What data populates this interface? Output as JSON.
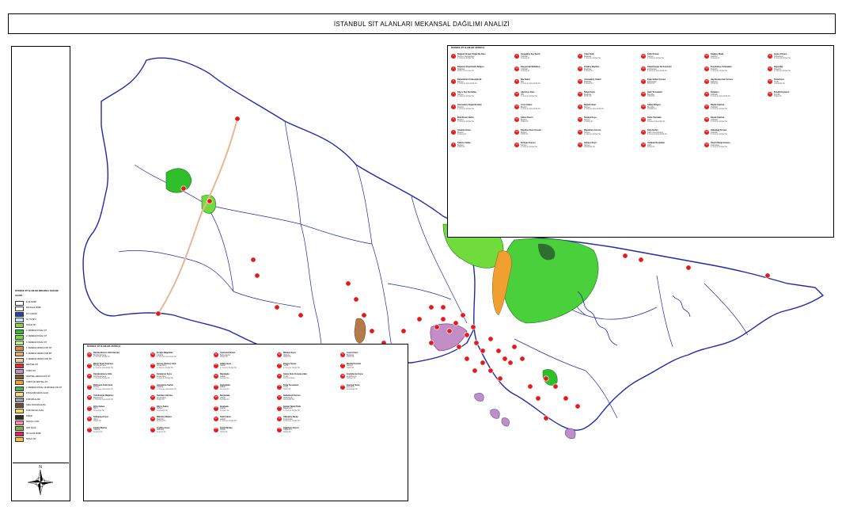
{
  "title": "İSTANBUL SİT ALANLARI MEKANSAL DAĞILIMI ANALİZİ",
  "legend": {
    "title": "İSTANBUL SİT ALANLARI MEKANSAL DAĞILIMI",
    "subtitle": "LEJANT",
    "items": [
      {
        "label": "İLÇE SINIRI",
        "color": "#ffffff"
      },
      {
        "label": "MAHALLE SINIRI",
        "color": "#ffffff"
      },
      {
        "label": "KIYI ÇİZGİSİ",
        "color": "#2a3fae"
      },
      {
        "label": "SU YÜZEYİ",
        "color": "#bfe4f7"
      },
      {
        "label": "DOĞAL SİT",
        "color": "#8ed24a"
      },
      {
        "label": "1. DERECE DOĞAL SİT",
        "color": "#2fbf2a"
      },
      {
        "label": "2. DERECE DOĞAL SİT",
        "color": "#6fdc3c"
      },
      {
        "label": "3. DERECE DOĞAL SİT",
        "color": "#b6ec86"
      },
      {
        "label": "1. DERECE ARKEOLOJİK SİT",
        "color": "#d98a4a"
      },
      {
        "label": "2. DERECE ARKEOLOJİK SİT",
        "color": "#e9a86f"
      },
      {
        "label": "3. DERECE ARKEOLOJİK SİT",
        "color": "#f3c9a0"
      },
      {
        "label": "KENTSEL SİT",
        "color": "#e03030"
      },
      {
        "label": "TARİHİ SİT",
        "color": "#c28ec6"
      },
      {
        "label": "KENTSEL ARKEOLOJİK SİT",
        "color": "#8c5a2a"
      },
      {
        "label": "TARİHİ VE KENTSEL SİT",
        "color": "#f0a030"
      },
      {
        "label": "1. DERECE DOĞAL VE ARKEOLOJİK SİT",
        "color": "#4caf50"
      },
      {
        "label": "ETKİLEŞİM GEÇİŞ ALANI",
        "color": "#f7e08a"
      },
      {
        "label": "KORUMA ALANI",
        "color": "#9e9e9e"
      },
      {
        "label": "ÖZEL KORUMA ALANI",
        "color": "#6d4c41"
      },
      {
        "label": "KORUNACAK ALAN",
        "color": "#ffd54f"
      },
      {
        "label": "DİĞER",
        "color": "#3e2723"
      },
      {
        "label": "TESCİLLİ YAPI",
        "color": "#f48fb1"
      },
      {
        "label": "ANIT AĞAÇ",
        "color": "#7cb342"
      },
      {
        "label": "SİT ALANI SINIRI",
        "color": "#e91e63"
      },
      {
        "label": "TESCİL NO",
        "color": "#fbc02d"
      }
    ]
  },
  "north_arrow": {
    "icon": "compass-rose-icon",
    "label": "N"
  },
  "tables": {
    "right": {
      "heading": "İSTANBUL SİT ALANLARI LİSTESİ (1)",
      "entries": [
        {
          "n": "1",
          "name": "Belgrad Ormanı Doğal Sit Alanı",
          "sub": "Sarıyer / Eyüpsultan",
          "detail": "1. Derece Doğal Sit"
        },
        {
          "n": "2",
          "name": "Boğaziçi Öngörünüm Bölgesi",
          "sub": "Beşiktaş",
          "detail": "Tarihi ve Kentsel Sit"
        },
        {
          "n": "3",
          "name": "Rumelifeneri Arkeolojik Sit",
          "sub": "Sarıyer",
          "detail": "1. Derece Arkeolojik Sit"
        },
        {
          "n": "4",
          "name": "Kilyos Kıyı Kumulları",
          "sub": "Sarıyer",
          "detail": "2. Derece Doğal Sit"
        },
        {
          "n": "5",
          "name": "Polonezköy Doğal Sit Alanı",
          "sub": "Beykoz",
          "detail": "1. Derece Doğal Sit"
        },
        {
          "n": "6",
          "name": "Riva Deresi Vadisi",
          "sub": "Beykoz",
          "detail": "2. Derece Doğal Sit"
        },
        {
          "n": "7",
          "name": "Anadolu Hisarı",
          "sub": "Beykoz",
          "detail": "Kentsel Sit"
        },
        {
          "n": "8",
          "name": "Kanlıca Yalıları",
          "sub": "Beykoz",
          "detail": "Tarihi Sit"
        },
        {
          "n": "9",
          "name": "Çengelköy Kıyı Şeridi",
          "sub": "Üsküdar",
          "detail": "Kentsel Sit"
        },
        {
          "n": "10",
          "name": "Kuzguncuk Mahallesi",
          "sub": "Üsküdar",
          "detail": "Kentsel Sit"
        },
        {
          "n": "11",
          "name": "Şile Kalesi",
          "sub": "Şile",
          "detail": "1. Derece Arkeolojik Sit"
        },
        {
          "n": "12",
          "name": "Ağva Kıyı Alanı",
          "sub": "Şile",
          "detail": "2. Derece Doğal Sit"
        },
        {
          "n": "13",
          "name": "Yoros Kalesi",
          "sub": "Beykoz",
          "detail": "1. Derece Arkeolojik Sit"
        },
        {
          "n": "14",
          "name": "Göksu Deresi",
          "sub": "Beykoz",
          "detail": "Doğal Sit"
        },
        {
          "n": "15",
          "name": "Küçüksu Kasrı Çevresi",
          "sub": "Beykoz",
          "detail": "Tarihi Sit"
        },
        {
          "n": "16",
          "name": "Emirgan Korusu",
          "sub": "Sarıyer",
          "detail": "1. Derece Doğal Sit"
        },
        {
          "n": "17",
          "name": "Yıldız Parkı",
          "sub": "Beşiktaş",
          "detail": "1. Derece Doğal Sit"
        },
        {
          "n": "18",
          "name": "Ortaköy Meydanı",
          "sub": "Beşiktaş",
          "detail": "Kentsel Sit"
        },
        {
          "n": "19",
          "name": "Arnavutköy Yalıları",
          "sub": "Beşiktaş",
          "detail": "Kentsel Sit"
        },
        {
          "n": "20",
          "name": "Bebek Koyu",
          "sub": "Beşiktaş",
          "detail": "Tarihi Sit"
        },
        {
          "n": "21",
          "name": "Rumeli Hisarı",
          "sub": "Sarıyer",
          "detail": "1. Derece Arkeolojik Sit"
        },
        {
          "n": "22",
          "name": "Tarabya Koyu",
          "sub": "Sarıyer",
          "detail": "Kentsel Sit"
        },
        {
          "n": "23",
          "name": "Büyükdere Korusu",
          "sub": "Sarıyer",
          "detail": "2. Derece Doğal Sit"
        },
        {
          "n": "24",
          "name": "Garipçe Köyü",
          "sub": "Sarıyer",
          "detail": "Arkeolojik Sit"
        },
        {
          "n": "25",
          "name": "Fatih Ormanı",
          "sub": "Sarıyer",
          "detail": "1. Derece Doğal Sit"
        },
        {
          "n": "26",
          "name": "Kemerburgaz Su Kemerleri",
          "sub": "Eyüpsultan",
          "detail": "1. Derece Arkeolojik Sit"
        },
        {
          "n": "27",
          "name": "Eyüp Sultan Çevresi",
          "sub": "Eyüpsultan",
          "detail": "Tarihi Sit"
        },
        {
          "n": "28",
          "name": "Haliç Tersaneleri",
          "sub": "Beyoğlu",
          "detail": "Tarihi Sit"
        },
        {
          "n": "29",
          "name": "Galata Bölgesi",
          "sub": "Beyoğlu",
          "detail": "Kentsel Sit"
        },
        {
          "n": "30",
          "name": "Tarihi Yarımada",
          "sub": "Fatih",
          "detail": "Kentsel Arkeolojik Sit"
        },
        {
          "n": "31",
          "name": "Kara Surları",
          "sub": "Fatih / Zeytinburnu",
          "detail": "1. Derece Arkeolojik Sit"
        },
        {
          "n": "32",
          "name": "Yedikule Bostanları",
          "sub": "Fatih",
          "detail": "Tarihi Sit"
        },
        {
          "n": "33",
          "name": "Kadıköy Moda",
          "sub": "Kadıköy",
          "detail": "Kentsel Sit"
        },
        {
          "n": "34",
          "name": "Fenerbahçe Yarımadası",
          "sub": "Kadıköy",
          "detail": "2. Derece Doğal Sit"
        },
        {
          "n": "35",
          "name": "Haydarpaşa Garı Çevresi",
          "sub": "Kadıköy",
          "detail": "Tarihi Sit"
        },
        {
          "n": "36",
          "name": "Kızkulesi",
          "sub": "Üsküdar",
          "detail": "1. Derece Arkeolojik Sit"
        },
        {
          "n": "37",
          "name": "Büyük Çamlıca",
          "sub": "Üsküdar",
          "detail": "1. Derece Doğal Sit"
        },
        {
          "n": "38",
          "name": "Küçük Çamlıca",
          "sub": "Üsküdar",
          "detail": "1. Derece Doğal Sit"
        },
        {
          "n": "39",
          "name": "Validebağ Korusu",
          "sub": "Üsküdar",
          "detail": "1. Derece Doğal Sit"
        },
        {
          "n": "40",
          "name": "Ömerli Barajı Havzası",
          "sub": "Çekmeköy",
          "detail": "2. Derece Doğal Sit"
        },
        {
          "n": "41",
          "name": "Aydos Ormanı",
          "sub": "Sultanbeyli",
          "detail": "1. Derece Doğal Sit"
        },
        {
          "n": "42",
          "name": "Kayışdağı",
          "sub": "Ataşehir",
          "detail": "2. Derece Doğal Sit"
        },
        {
          "n": "43",
          "name": "Tuzla Kıyısı",
          "sub": "Tuzla",
          "detail": "Arkeolojik Sit"
        },
        {
          "n": "44",
          "name": "Pendik Kaynarca",
          "sub": "Pendik",
          "detail": "Doğal Sit"
        }
      ]
    },
    "bottom": {
      "heading": "İSTANBUL SİT ALANLARI LİSTESİ (2)",
      "entries": [
        {
          "n": "45",
          "name": "Büyükçekmece Gölü Havzası",
          "sub": "Büyükçekmece",
          "detail": "2. Derece Doğal Sit"
        },
        {
          "n": "46",
          "name": "Mimar Sinan Köprüsü",
          "sub": "Büyükçekmece",
          "detail": "1. Derece Arkeolojik Sit"
        },
        {
          "n": "47",
          "name": "Küçükçekmece Gölü",
          "sub": "Küçükçekmece",
          "detail": "1. Derece Doğal Sit"
        },
        {
          "n": "48",
          "name": "Bathonea Antik Kenti",
          "sub": "Avcılar",
          "detail": "1. Derece Arkeolojik Sit"
        },
        {
          "n": "49",
          "name": "Yarımburgaz Mağarası",
          "sub": "Başakşehir",
          "detail": "1. Derece Arkeolojik Sit"
        },
        {
          "n": "50",
          "name": "Silivri Kalesi",
          "sub": "Silivri",
          "detail": "Arkeolojik Sit"
        },
        {
          "n": "51",
          "name": "Selimpaşa Kıyısı",
          "sub": "Silivri",
          "detail": "Doğal Sit"
        },
        {
          "n": "52",
          "name": "Çatalca Merkez",
          "sub": "Çatalca",
          "detail": "Kentsel Sit"
        },
        {
          "n": "53",
          "name": "İnceğiz Mağaraları",
          "sub": "Çatalca",
          "detail": "1. Derece Arkeolojik Sit"
        },
        {
          "n": "54",
          "name": "Durusu (Terkos) Gölü",
          "sub": "Arnavutköy",
          "detail": "1. Derece Doğal Sit"
        },
        {
          "n": "55",
          "name": "Karaburun Kıyısı",
          "sub": "Arnavutköy",
          "detail": "2. Derece Doğal Sit"
        },
        {
          "n": "56",
          "name": "Anastasius Surları",
          "sub": "Çatalca",
          "detail": "1. Derece Arkeolojik Sit"
        },
        {
          "n": "57",
          "name": "Sazlıdere Havzası",
          "sub": "Arnavutköy",
          "detail": "Doğal Sit"
        },
        {
          "n": "58",
          "name": "Kilyos Kalesi",
          "sub": "Sarıyer",
          "detail": "Arkeolojik Sit"
        },
        {
          "n": "59",
          "name": "Bakırköy Merkez",
          "sub": "Bakırköy",
          "detail": "Kentsel Sit"
        },
        {
          "n": "60",
          "name": "Yeşilköy Kıyısı",
          "sub": "Bakırköy",
          "detail": "Kentsel Sit"
        },
        {
          "n": "61",
          "name": "Ayamama Deresi",
          "sub": "Bahçelievler",
          "detail": "Doğal Sit"
        },
        {
          "n": "62",
          "name": "Adalar İlçesi",
          "sub": "Adalar",
          "detail": "1. Derece Doğal Sit"
        },
        {
          "n": "63",
          "name": "Büyükada",
          "sub": "Adalar",
          "detail": "Kentsel Sit"
        },
        {
          "n": "64",
          "name": "Heybeliada",
          "sub": "Adalar",
          "detail": "Kentsel Sit"
        },
        {
          "n": "65",
          "name": "Burgazada",
          "sub": "Adalar",
          "detail": "Kentsel Sit"
        },
        {
          "n": "66",
          "name": "Kınalıada",
          "sub": "Adalar",
          "detail": "Kentsel Sit"
        },
        {
          "n": "67",
          "name": "Sedef Adası",
          "sub": "Adalar",
          "detail": "2. Derece Doğal Sit"
        },
        {
          "n": "68",
          "name": "Kartal Merkez",
          "sub": "Kartal",
          "detail": "Tarihi Sit"
        },
        {
          "n": "69",
          "name": "Maltepe Kıyısı",
          "sub": "Maltepe",
          "detail": "Doğal Sit"
        },
        {
          "n": "70",
          "name": "Dragos Tepesi",
          "sub": "Kartal",
          "detail": "2. Derece Doğal Sit"
        },
        {
          "n": "71",
          "name": "Gebze Sınırı Koruma Alanı",
          "sub": "Tuzla",
          "detail": "Koruma Alanı"
        },
        {
          "n": "72",
          "name": "Tuzla Tersaneleri",
          "sub": "Tuzla",
          "detail": "Tarihi Sit"
        },
        {
          "n": "73",
          "name": "Sultanbeyli Kemeri",
          "sub": "Sultanbeyli",
          "detail": "Arkeolojik Sit"
        },
        {
          "n": "74",
          "name": "Şamlar Tabiat Parkı",
          "sub": "Başakşehir",
          "detail": "1. Derece Doğal Sit"
        },
        {
          "n": "75",
          "name": "Alibeyköy Barajı",
          "sub": "Eyüpsultan",
          "detail": "2. Derece Doğal Sit"
        },
        {
          "n": "76",
          "name": "Kağıthane Deresi",
          "sub": "Kağıthane",
          "detail": "Doğal Sit"
        },
        {
          "n": "77",
          "name": "Levent Kasrı",
          "sub": "Beşiktaş",
          "detail": "Tarihi Sit"
        },
        {
          "n": "78",
          "name": "Maslak Kasırları",
          "sub": "Sarıyer",
          "detail": "Tarihi Sit"
        },
        {
          "n": "79",
          "name": "Zeytinburnu Kıyısı",
          "sub": "Zeytinburnu",
          "detail": "Kentsel Sit"
        },
        {
          "n": "80",
          "name": "Esenyurt Kıraç",
          "sub": "Esenyurt",
          "detail": "Arkeolojik Sit"
        }
      ]
    }
  }
}
